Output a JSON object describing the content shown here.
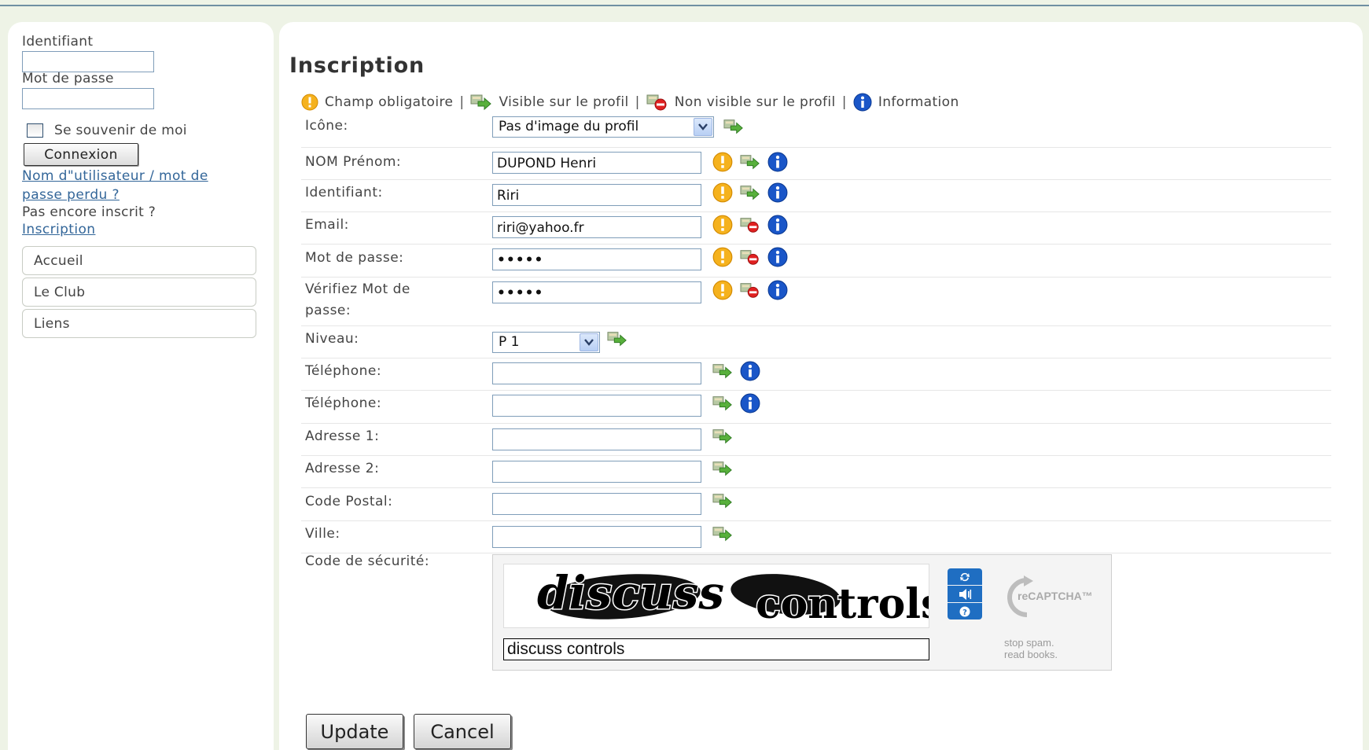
{
  "login": {
    "username_label": "Identifiant",
    "username_value": "",
    "password_label": "Mot de passe",
    "password_value": "",
    "remember_label": "Se souvenir de moi",
    "connect_button": "Connexion",
    "forgot_link_line1": "Nom d\"utilisateur / mot de",
    "forgot_link_line2": "passe perdu ?",
    "not_registered": "Pas encore inscrit ?",
    "register_link": "Inscription"
  },
  "nav": {
    "items": [
      "Accueil",
      "Le Club",
      "Liens"
    ]
  },
  "form": {
    "title": "Inscription",
    "legend": {
      "required": "Champ obligatoire",
      "visible": "Visible sur le profil",
      "not_visible": "Non visible sur le profil",
      "info": "Information",
      "separator": "|"
    },
    "fields": {
      "icone": {
        "label": "Icône:",
        "value": "Pas d'image du profil",
        "icons": [
          "visible-icon"
        ]
      },
      "nom": {
        "label": "NOM Prénom:",
        "value": "DUPOND Henri",
        "icons": [
          "required-icon",
          "visible-icon",
          "info-icon"
        ]
      },
      "identifiant": {
        "label": "Identifiant:",
        "value": "Riri",
        "icons": [
          "required-icon",
          "visible-icon",
          "info-icon"
        ]
      },
      "email": {
        "label": "Email:",
        "value": "riri@yahoo.fr",
        "icons": [
          "required-icon",
          "not-visible-icon",
          "info-icon"
        ]
      },
      "password": {
        "label": "Mot de passe:",
        "value": "•••••",
        "icons": [
          "required-icon",
          "not-visible-icon",
          "info-icon"
        ]
      },
      "password_verify": {
        "label_line1": "Vérifiez Mot de",
        "label_line2": "passe:",
        "value": "•••••",
        "icons": [
          "required-icon",
          "not-visible-icon",
          "info-icon"
        ]
      },
      "niveau": {
        "label": "Niveau:",
        "value": "P 1",
        "icons": [
          "visible-icon"
        ]
      },
      "telephone1": {
        "label": "Téléphone:",
        "value": "",
        "icons": [
          "visible-icon",
          "info-icon"
        ]
      },
      "telephone2": {
        "label": "Téléphone:",
        "value": "",
        "icons": [
          "visible-icon",
          "info-icon"
        ]
      },
      "adresse1": {
        "label": "Adresse 1:",
        "value": "",
        "icons": [
          "visible-icon"
        ]
      },
      "adresse2": {
        "label": "Adresse 2:",
        "value": "",
        "icons": [
          "visible-icon"
        ]
      },
      "code_postal": {
        "label": "Code Postal:",
        "value": "",
        "icons": [
          "visible-icon"
        ]
      },
      "ville": {
        "label": "Ville:",
        "value": "",
        "icons": [
          "visible-icon"
        ]
      },
      "captcha": {
        "label": "Code de sécurité:"
      }
    },
    "captcha": {
      "word1": "discuss",
      "word2": "controls",
      "response_value": "discuss controls",
      "brand_line1": "stop spam.",
      "brand_line2": "read books.",
      "logo_text": "reCAPTCHA™"
    },
    "buttons": {
      "update": "Update",
      "cancel": "Cancel"
    }
  },
  "colors": {
    "page_bg": "#eef3e6",
    "link": "#336699",
    "required": "#f0a020",
    "info": "#1a56c8",
    "not_visible": "#e02020",
    "recaptcha_blue": "#1f6ec2"
  }
}
